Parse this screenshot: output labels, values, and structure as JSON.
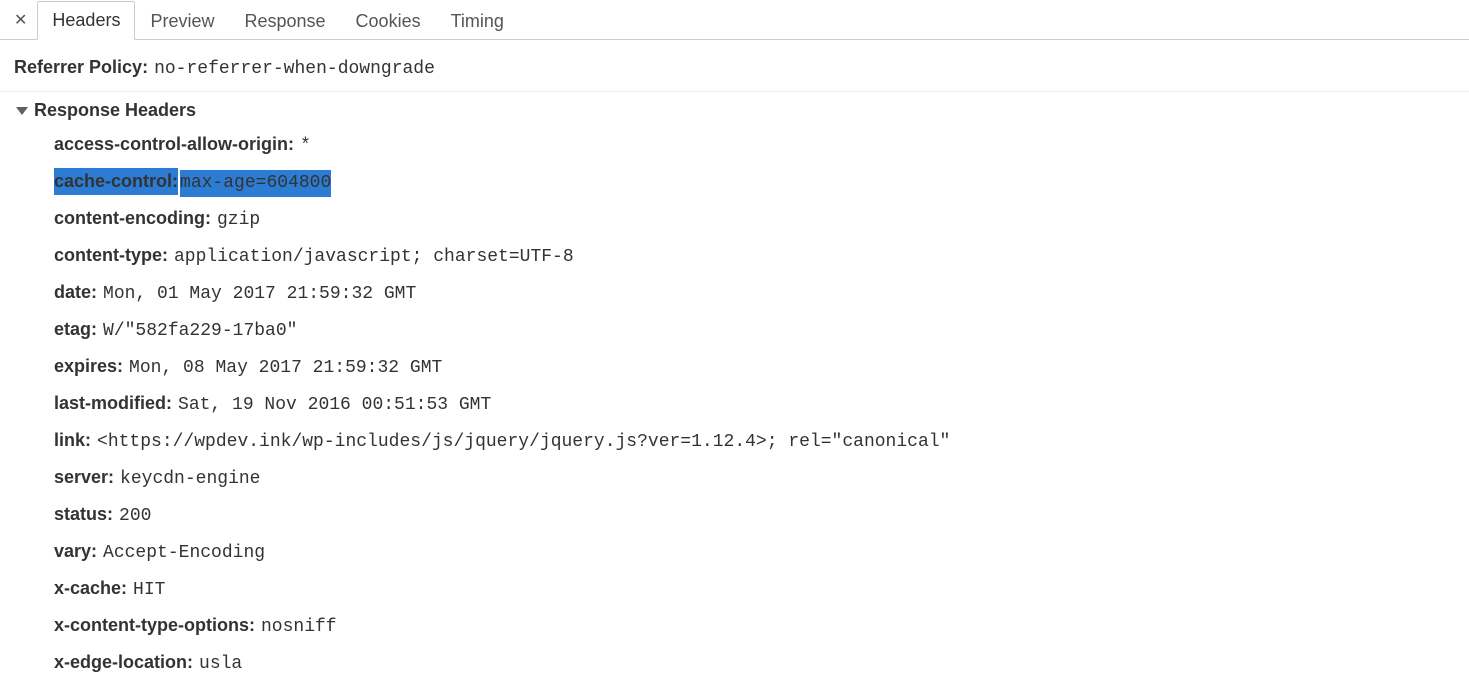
{
  "tabs": {
    "headers": "Headers",
    "preview": "Preview",
    "response": "Response",
    "cookies": "Cookies",
    "timing": "Timing"
  },
  "general": {
    "referrer_policy_label": "Referrer Policy:",
    "referrer_policy_value": "no-referrer-when-downgrade"
  },
  "response_headers_title": "Response Headers",
  "headers": {
    "access_control_allow_origin": {
      "name": "access-control-allow-origin:",
      "value": "*"
    },
    "cache_control": {
      "name": "cache-control:",
      "value": "max-age=604800"
    },
    "content_encoding": {
      "name": "content-encoding:",
      "value": "gzip"
    },
    "content_type": {
      "name": "content-type:",
      "value": "application/javascript; charset=UTF-8"
    },
    "date": {
      "name": "date:",
      "value": "Mon, 01 May 2017 21:59:32 GMT"
    },
    "etag": {
      "name": "etag:",
      "value": "W/\"582fa229-17ba0\""
    },
    "expires": {
      "name": "expires:",
      "value": "Mon, 08 May 2017 21:59:32 GMT"
    },
    "last_modified": {
      "name": "last-modified:",
      "value": "Sat, 19 Nov 2016 00:51:53 GMT"
    },
    "link": {
      "name": "link:",
      "value": "<https://wpdev.ink/wp-includes/js/jquery/jquery.js?ver=1.12.4>; rel=\"canonical\""
    },
    "server": {
      "name": "server:",
      "value": "keycdn-engine"
    },
    "status": {
      "name": "status:",
      "value": "200"
    },
    "vary": {
      "name": "vary:",
      "value": "Accept-Encoding"
    },
    "x_cache": {
      "name": "x-cache:",
      "value": "HIT"
    },
    "x_content_type_options": {
      "name": "x-content-type-options:",
      "value": "nosniff"
    },
    "x_edge_location": {
      "name": "x-edge-location:",
      "value": "usla"
    }
  }
}
